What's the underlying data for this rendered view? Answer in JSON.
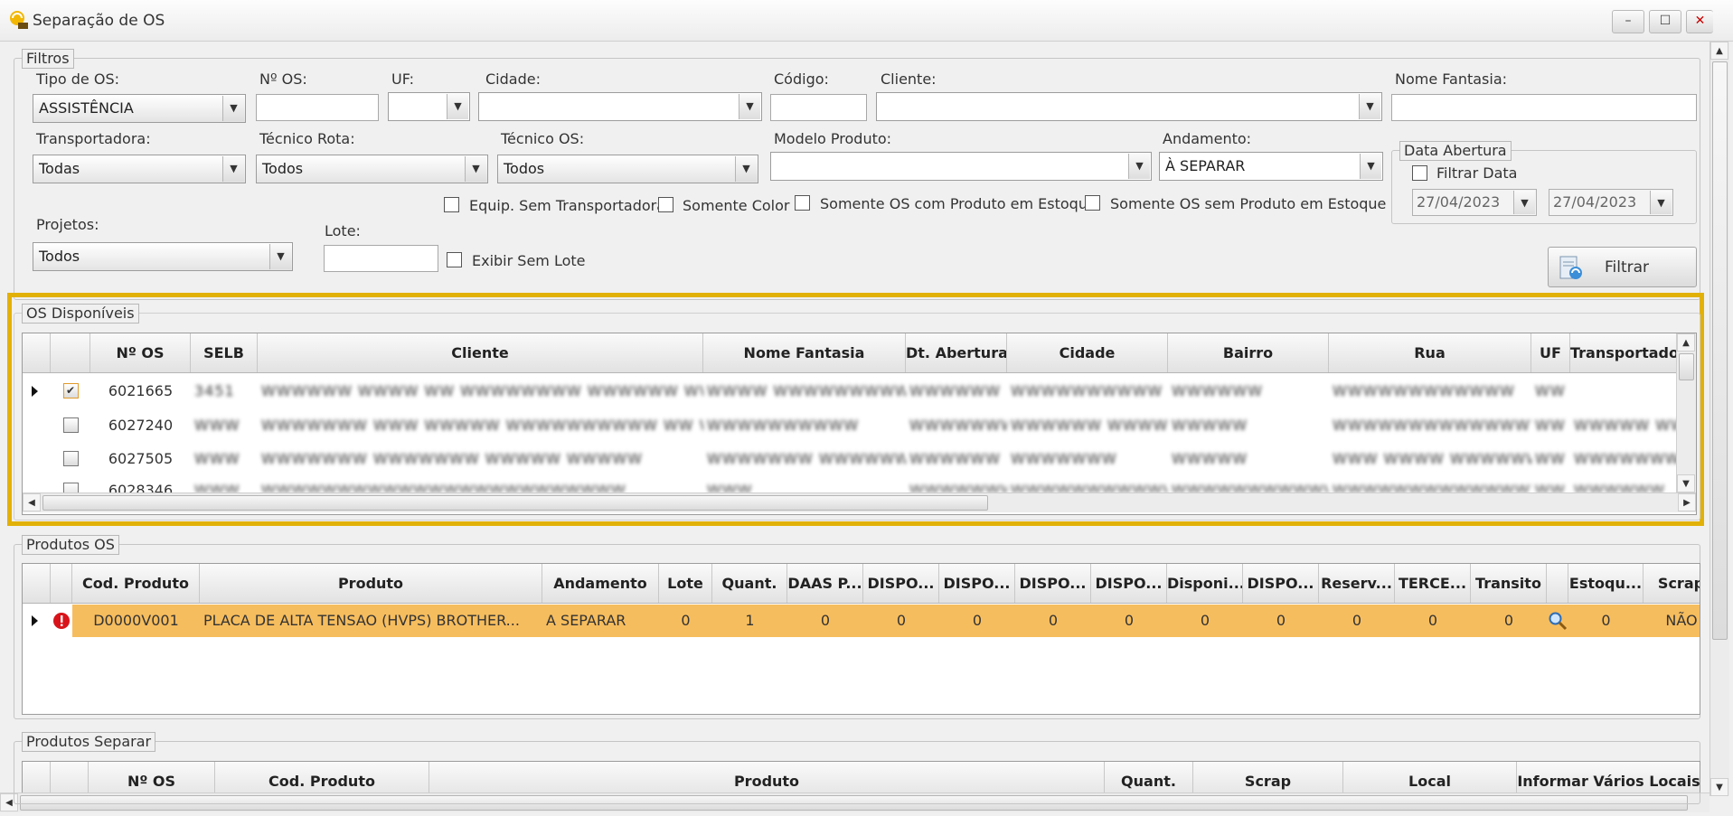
{
  "window": {
    "title": "Separação de OS",
    "controls": {
      "minimize": "–",
      "maximize": "☐",
      "close": "✕"
    }
  },
  "filtros": {
    "legend": "Filtros",
    "tipo_os": {
      "label": "Tipo de OS:",
      "value": "ASSISTÊNCIA"
    },
    "n_os": {
      "label": "Nº OS:",
      "value": ""
    },
    "uf": {
      "label": "UF:",
      "value": ""
    },
    "cidade": {
      "label": "Cidade:",
      "value": ""
    },
    "codigo": {
      "label": "Código:",
      "value": ""
    },
    "cliente": {
      "label": "Cliente:",
      "value": ""
    },
    "nome_fantasia": {
      "label": "Nome Fantasia:",
      "value": ""
    },
    "transportadora": {
      "label": "Transportadora:",
      "value": "Todas"
    },
    "tecnico_rota": {
      "label": "Técnico Rota:",
      "value": "Todos"
    },
    "tecnico_os": {
      "label": "Técnico OS:",
      "value": "Todos"
    },
    "modelo_produto": {
      "label": "Modelo Produto:",
      "value": ""
    },
    "andamento": {
      "label": "Andamento:",
      "value": "À SEPARAR"
    },
    "projetos": {
      "label": "Projetos:",
      "value": "Todos"
    },
    "lote": {
      "label": "Lote:",
      "value": ""
    },
    "equip_sem_transportadora": "Equip. Sem Transportadora",
    "somente_color": "Somente Color",
    "somente_com_estoque": "Somente OS com Produto em Estoque",
    "somente_sem_estoque": "Somente OS sem Produto em Estoque",
    "exibir_sem_lote": "Exibir Sem Lote",
    "data_abertura": {
      "legend": "Data Abertura",
      "filtrar_data": "Filtrar Data",
      "de": "27/04/2023",
      "ate": "27/04/2023"
    },
    "filtrar_button": "Filtrar"
  },
  "os_disponiveis": {
    "legend": "OS Disponíveis",
    "columns": [
      "Nº OS",
      "SELB",
      "Cliente",
      "Nome Fantasia",
      "Dt. Abertura",
      "Cidade",
      "Bairro",
      "Rua",
      "UF",
      "Transportadora"
    ],
    "rows": [
      {
        "n_os": "6021665",
        "selb": "3451",
        "cliente": "WWWWWW WWWW WW WWWWWWWW WWWWWW WWWW",
        "fantasia": "WWWW WWWWWWWWWWW",
        "dt": "WWWWWW",
        "cidade": "WWWWWWWWWW",
        "bairro": "WWWWWW",
        "rua": "WWWWWWWWWWWW",
        "uf": "WW",
        "transp": ""
      },
      {
        "n_os": "6027240",
        "selb": "WWW",
        "cliente": "WWWWWWW WWW WWWWW WWWWWWWWWW WW WWWWW WWW",
        "fantasia": "WWWWWWWWWW",
        "dt": "WWWWWWWW",
        "cidade": "WWWWWW WWWWW",
        "bairro": "WWWWW",
        "rua": "WWWWWWWWWWWWWW",
        "uf": "WW",
        "transp": "WWWWW WWWW"
      },
      {
        "n_os": "6027505",
        "selb": "WWW",
        "cliente": "WWWWWWW WWWWWWW WWWWW WWWWW",
        "fantasia": "WWWWWWW WWWWWWWWW",
        "dt": "WWWWWW",
        "cidade": "WWWWWWW",
        "bairro": "WWWWW",
        "rua": "WWW WWWW WWWWWWW W",
        "uf": "WW",
        "transp": "WWWWWWWW"
      },
      {
        "n_os": "6028346",
        "selb": "WWW",
        "cliente": "WWWWWWWWWWWWWWWWWWWWWWWW",
        "fantasia": "WWW",
        "dt": "WWWWWWWW",
        "cidade": "WWWWWWWWWWWW",
        "bairro": "WWWWWWWWWWWW",
        "rua": "WWWWWWWWWWWWWW",
        "uf": "WW",
        "transp": "WWWWWW"
      }
    ]
  },
  "produtos_os": {
    "legend": "Produtos OS",
    "columns": [
      "Cod. Produto",
      "Produto",
      "Andamento",
      "Lote",
      "Quant.",
      "DAAS P...",
      "DISPO...",
      "DISPO...",
      "DISPO...",
      "DISPO...",
      "Disponi...",
      "DISPO...",
      "Reserv...",
      "TERCE...",
      "Transito",
      "",
      "Estoqu...",
      "Scrap"
    ],
    "row": {
      "cod": "D0000V001",
      "produto": "PLACA DE ALTA TENSAO (HVPS) BROTHER...",
      "andamento": "A SEPARAR",
      "lote": "0",
      "quant": "1",
      "v1": "0",
      "v2": "0",
      "v3": "0",
      "v4": "0",
      "v5": "0",
      "v6": "0",
      "v7": "0",
      "v8": "0",
      "v9": "0",
      "v10": "0",
      "estoque": "0",
      "scrap": "NÃO"
    }
  },
  "produtos_separar": {
    "legend": "Produtos Separar",
    "columns": [
      "Nº OS",
      "Cod. Produto",
      "Produto",
      "Quant.",
      "Scrap",
      "Local",
      "Informar Vários Locais"
    ]
  },
  "colors": {
    "highlight": "#e2b108",
    "selected_row": "#f6bd5e",
    "error": "#d8141a"
  }
}
